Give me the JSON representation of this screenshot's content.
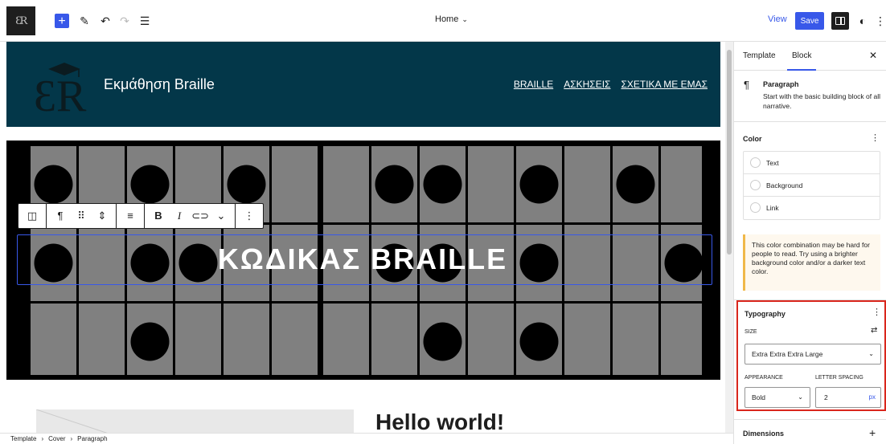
{
  "topbar": {
    "logo_text": "ƐR",
    "inserter_label": "+",
    "doc_title": "Home",
    "view_label": "View",
    "save_label": "Save"
  },
  "header": {
    "site_title": "Εκμάθηση Braille",
    "nav": [
      "BRAILLE",
      "ΑΣΚΗΣΕΙΣ",
      "ΣΧΕΤΙΚΑ ΜΕ ΕΜΑΣ"
    ],
    "background": "#033749"
  },
  "cover": {
    "heading": "ΚΩΔΙΚΑΣ BRAILLE"
  },
  "post": {
    "title": "Hello world!"
  },
  "breadcrumb": [
    "Template",
    "Cover",
    "Paragraph"
  ],
  "sidebar": {
    "tabs": [
      "Template",
      "Block"
    ],
    "active_tab": "Block",
    "block": {
      "name": "Paragraph",
      "description": "Start with the basic building block of all narrative."
    },
    "color": {
      "title": "Color",
      "items": [
        "Text",
        "Background",
        "Link"
      ],
      "notice": "This color combination may be hard for people to read. Try using a brighter background color and/or a darker text color."
    },
    "typography": {
      "title": "Typography",
      "size_label": "SIZE",
      "size_value": "Extra Extra Extra Large",
      "appearance_label": "APPEARANCE",
      "appearance_value": "Bold",
      "letter_spacing_label": "LETTER SPACING",
      "letter_spacing_value": "2",
      "letter_spacing_unit": "px"
    },
    "dimensions": {
      "title": "Dimensions"
    }
  },
  "colors": {
    "accent": "#3858e9",
    "highlight": "#d9261c",
    "warning": "#f0b849"
  }
}
